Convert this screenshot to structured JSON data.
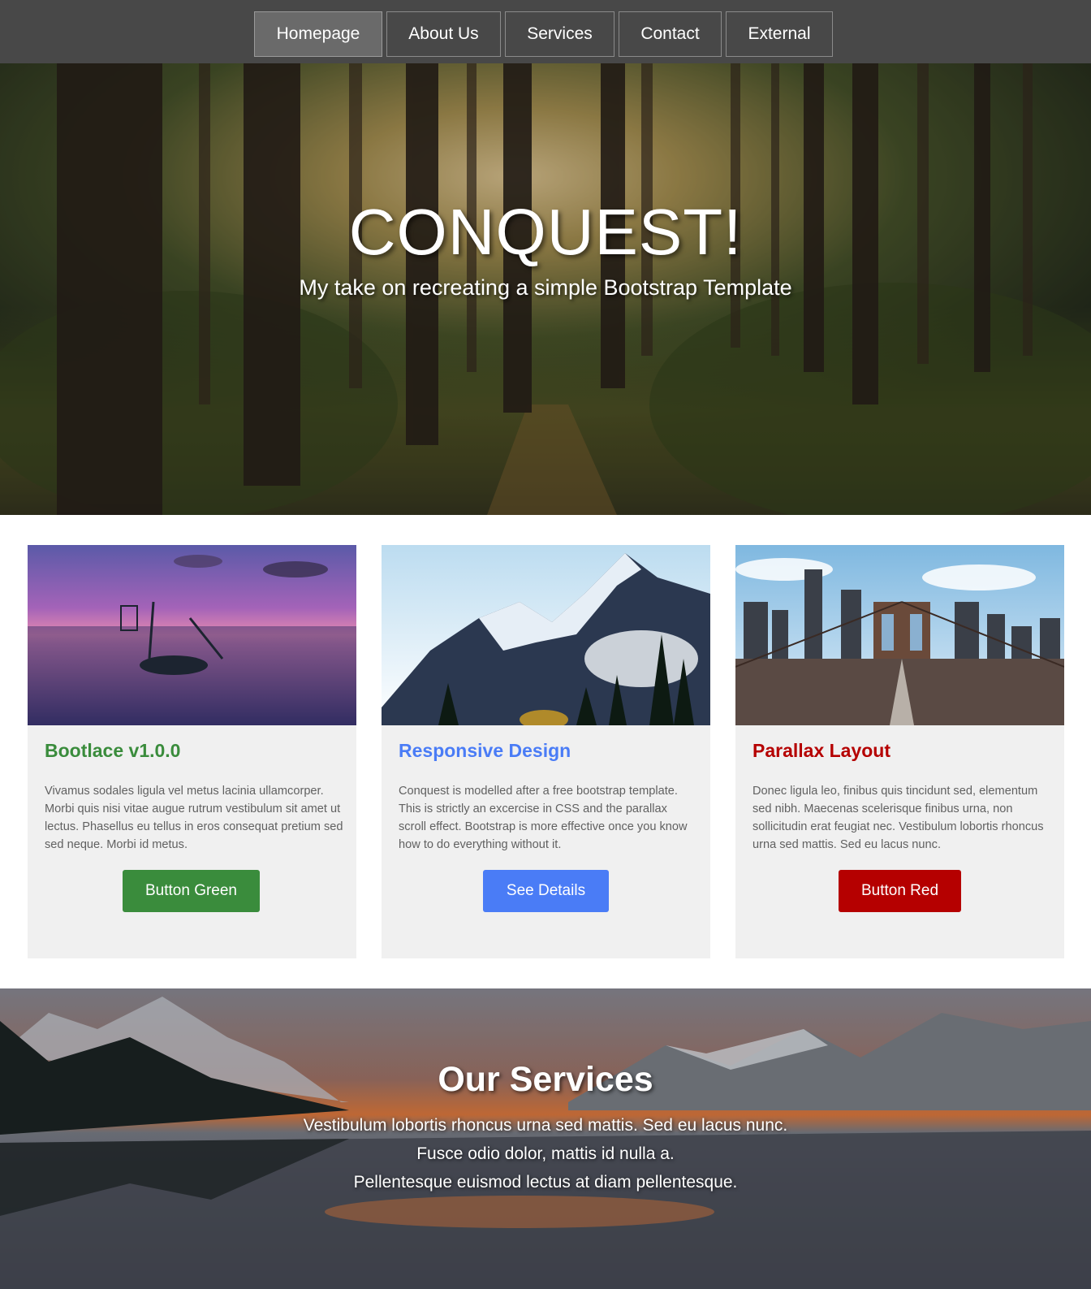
{
  "nav": {
    "items": [
      {
        "label": "Homepage"
      },
      {
        "label": "About Us"
      },
      {
        "label": "Services"
      },
      {
        "label": "Contact"
      },
      {
        "label": "External"
      }
    ]
  },
  "hero": {
    "title": "CONQUEST!",
    "subtitle": "My take on recreating a simple Bootstrap Template"
  },
  "cards": [
    {
      "title": "Bootlace v1.0.0",
      "text": "Vivamus sodales ligula vel metus lacinia ullamcorper. Morbi quis nisi vitae augue rutrum vestibulum sit amet ut lectus. Phasellus eu tellus in eros consequat pretium sed sed neque. Morbi id metus.",
      "button": "Button Green",
      "accent": "#3a8c3c"
    },
    {
      "title": "Responsive Design",
      "text": "Conquest is modelled after a free bootstrap template. This is strictly an excercise in CSS and the parallax scroll effect. Bootstrap is more effective once you know how to do everything without it.",
      "button": "See Details",
      "accent": "#4a7cf6"
    },
    {
      "title": "Parallax Layout",
      "text": "Donec ligula leo, finibus quis tincidunt sed, elementum sed nibh. Maecenas scelerisque finibus urna, non sollicitudin erat feugiat nec. Vestibulum lobortis rhoncus urna sed mattis. Sed eu lacus nunc.",
      "button": "Button Red",
      "accent": "#b50000"
    }
  ],
  "services": {
    "title": "Our Services",
    "lines": [
      "Vestibulum lobortis rhoncus urna sed mattis. Sed eu lacus nunc.",
      "Fusce odio dolor, mattis id nulla a.",
      "Pellentesque euismod lectus at diam pellentesque."
    ]
  }
}
